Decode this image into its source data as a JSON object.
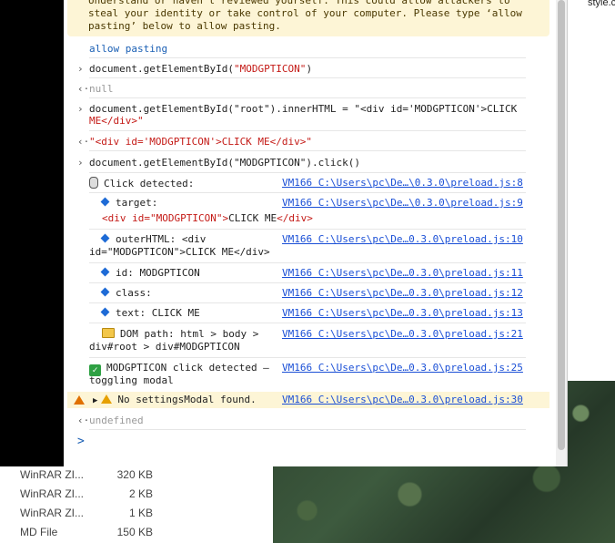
{
  "console": {
    "warning_text": "Understand or haven't reviewed yourself. This could allow attackers to\nsteal your identity or take control of your computer. Please type ‘allow\npasting’ below to allow pasting.",
    "entries": [
      {
        "kind": "input",
        "text": "allow pasting"
      },
      {
        "kind": "input",
        "text_prefix": "document.getElementById(",
        "arg": "\"MODGPTICON\"",
        "text_suffix": ")"
      },
      {
        "kind": "result",
        "text": "null"
      },
      {
        "kind": "input",
        "line1": "document.getElementById(\"root\").innerHTML = \"<div id='MODGPTICON'>CLICK",
        "line2": "ME</div>\""
      },
      {
        "kind": "result",
        "text": "\"<div id='MODGPTICON'>CLICK ME</div>\""
      },
      {
        "kind": "input",
        "text": "document.getElementById(\"MODGPTICON\").click()"
      }
    ],
    "logs": [
      {
        "icon": "mouse-icon",
        "label": "Click detected:",
        "source": "VM166 C:\\Users\\pc\\De…\\0.3.0\\preload.js:8"
      },
      {
        "icon": "diamond-icon",
        "label": "target:",
        "detail": "<div id=\"MODGPTICON\">CLICK ME</div>",
        "source": "VM166 C:\\Users\\pc\\De…\\0.3.0\\preload.js:9"
      },
      {
        "icon": "diamond-icon",
        "label": "outerHTML: <div",
        "detail": "id=\"MODGPTICON\">CLICK ME</div>",
        "source": "VM166 C:\\Users\\pc\\De…0.3.0\\preload.js:10"
      },
      {
        "icon": "diamond-icon",
        "label": "id: MODGPTICON",
        "source": "VM166 C:\\Users\\pc\\De…0.3.0\\preload.js:11"
      },
      {
        "icon": "diamond-icon",
        "label": "class:",
        "source": "VM166 C:\\Users\\pc\\De…0.3.0\\preload.js:12"
      },
      {
        "icon": "diamond-icon",
        "label": "text: CLICK ME",
        "source": "VM166 C:\\Users\\pc\\De…0.3.0\\preload.js:13"
      },
      {
        "icon": "folder-icon",
        "label": "DOM path: html > body >",
        "detail": "div#root > div#MODGPTICON",
        "source": "VM166 C:\\Users\\pc\\De…0.3.0\\preload.js:21"
      },
      {
        "icon": "check-icon",
        "label": "MODGPTICON click detected —",
        "detail": "toggling modal",
        "source": "VM166 C:\\Users\\pc\\De…0.3.0\\preload.js:25"
      },
      {
        "icon": "warning-icon",
        "label": "No settingsModal found.",
        "source": "VM166 C:\\Users\\pc\\De…0.3.0\\preload.js:30"
      }
    ],
    "final_result": "undefined",
    "prompt_symbol": ">"
  },
  "files": [
    {
      "name": "WinRAR ZI...",
      "size": "320 KB"
    },
    {
      "name": "WinRAR ZI...",
      "size": "2 KB"
    },
    {
      "name": "WinRAR ZI...",
      "size": "1 KB"
    },
    {
      "name": "MD File",
      "size": "150 KB"
    }
  ],
  "corner_text": "style.c",
  "colors": {
    "warning_bg": "#fdf5d6",
    "link": "#1a4fd6",
    "string": "#c41a16"
  }
}
